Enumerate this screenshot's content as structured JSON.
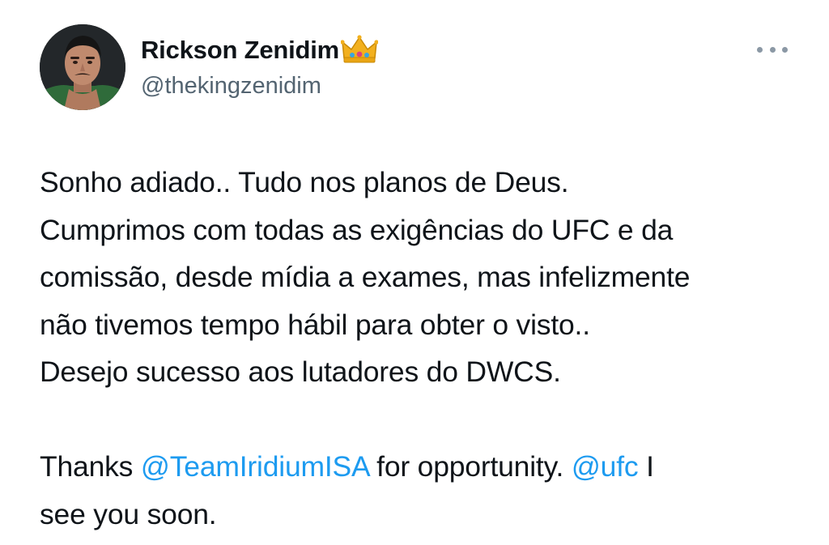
{
  "author": {
    "display_name": "Rickson Zenidim",
    "badge_emoji": "crown-icon",
    "handle": "@thekingzenidim"
  },
  "tweet": {
    "lines": [
      "Sonho adiado.. Tudo nos planos de Deus.",
      "Cumprimos com todas as exigências do UFC e da",
      "comissão, desde mídia a exames, mas infelizmente",
      "não tivemos tempo hábil para obter o visto..",
      "Desejo sucesso aos lutadores do DWCS."
    ],
    "thanks_prefix": "Thanks ",
    "mention_1": "@TeamIridiumISA",
    "thanks_middle": " for opportunity. ",
    "mention_2": "@ufc",
    "thanks_suffix": " I",
    "last_line": "see you soon."
  },
  "colors": {
    "text": "#0f1419",
    "secondary": "#536471",
    "link": "#1d9bf0"
  },
  "icons": {
    "more": "more-horizontal-icon",
    "badge": "crown-icon"
  }
}
